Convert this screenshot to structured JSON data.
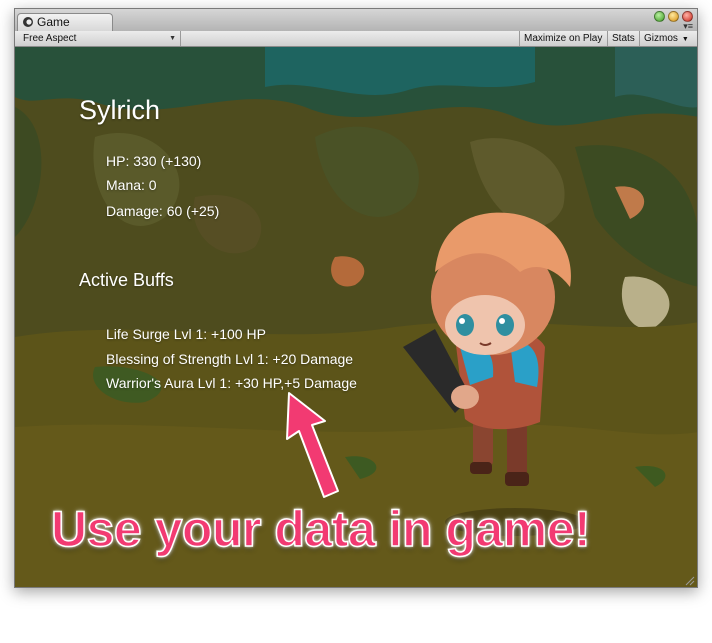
{
  "window": {
    "tab_label": "Game",
    "tab_icon": "unity-game-icon"
  },
  "toolbar": {
    "aspect_value": "Free Aspect",
    "maximize_label": "Maximize on Play",
    "stats_label": "Stats",
    "gizmos_label": "Gizmos"
  },
  "character": {
    "name": "Sylrich",
    "hp": "HP: 330 (+130)",
    "mana": "Mana: 0",
    "damage": "Damage: 60 (+25)"
  },
  "buffs": {
    "title": "Active Buffs",
    "items": [
      "Life Surge Lvl 1: +100 HP",
      "Blessing of Strength Lvl 1: +20 Damage",
      "Warrior's Aura Lvl 1: +30 HP,+5 Damage"
    ]
  },
  "annotation": {
    "callout": "Use your data in game!",
    "color": "#f23a72"
  }
}
